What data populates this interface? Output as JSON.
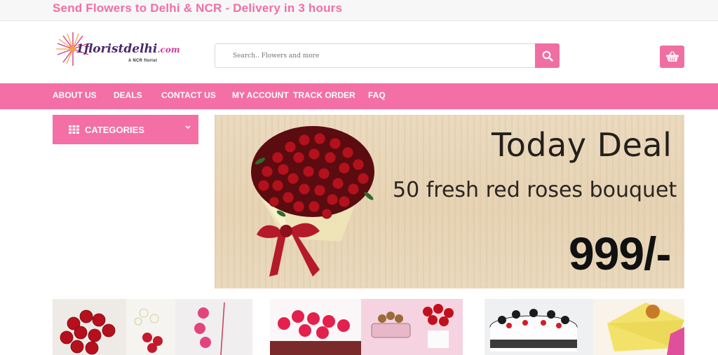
{
  "topbar": {
    "promo_text": "Send Flowers to Delhi & NCR - Delivery in 3 hours"
  },
  "header": {
    "logo_text_main": "1floristdelhi",
    "logo_text_domain": ".com",
    "logo_tagline": "A NCR florist",
    "search_placeholder": "Search.. Flowers and more",
    "search_icon": "search-icon",
    "cart_icon": "basket-icon"
  },
  "nav": {
    "items": [
      {
        "label": "ABOUT US"
      },
      {
        "label": "DEALS"
      },
      {
        "label": "CONTACT US"
      },
      {
        "label": "MY ACCOUNT"
      },
      {
        "label": "TRACK ORDER"
      },
      {
        "label": "FAQ"
      }
    ]
  },
  "categories": {
    "label": "CATEGORIES",
    "icon": "grid-icon",
    "toggle_icon": "chevron-down-icon"
  },
  "banner": {
    "title": "Today Deal",
    "subtitle": "50 fresh red roses bouquet",
    "price": "999/-"
  },
  "colors": {
    "brand_pink": "#f36fa5",
    "topbar_text": "#f06fa3"
  }
}
